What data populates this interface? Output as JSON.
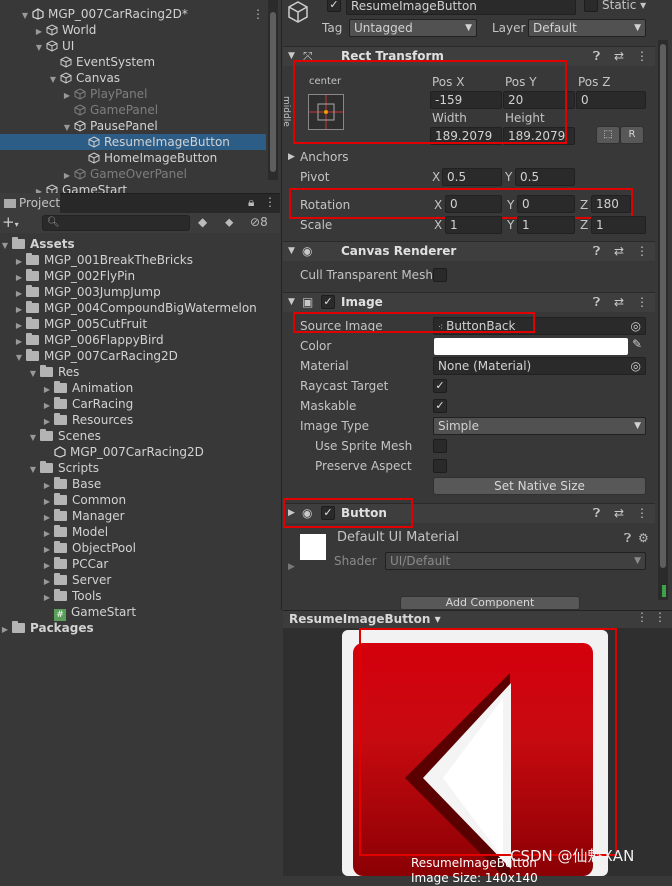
{
  "hierarchy": {
    "rows": [
      {
        "label": "MGP_007CarRacing2D*",
        "indent": 1,
        "arrow": "▼",
        "icon": "unity-scene-icon"
      },
      {
        "label": "World",
        "indent": 2,
        "arrow": "▶",
        "icon": "cube-icon"
      },
      {
        "label": "UI",
        "indent": 2,
        "arrow": "▼",
        "icon": "cube-icon"
      },
      {
        "label": "EventSystem",
        "indent": 3,
        "arrow": "",
        "icon": "cube-icon"
      },
      {
        "label": "Canvas",
        "indent": 3,
        "arrow": "▼",
        "icon": "cube-icon"
      },
      {
        "label": "PlayPanel",
        "indent": 4,
        "arrow": "▶",
        "icon": "cube-icon",
        "dim": true
      },
      {
        "label": "GamePanel",
        "indent": 4,
        "arrow": "",
        "icon": "cube-icon",
        "dim": true
      },
      {
        "label": "PausePanel",
        "indent": 4,
        "arrow": "▼",
        "icon": "cube-icon"
      },
      {
        "label": "ResumeImageButton",
        "indent": 5,
        "arrow": "",
        "icon": "cube-icon",
        "selected": true
      },
      {
        "label": "HomeImageButton",
        "indent": 5,
        "arrow": "",
        "icon": "cube-icon"
      },
      {
        "label": "GameOverPanel",
        "indent": 4,
        "arrow": "▶",
        "icon": "cube-icon",
        "dim": true
      },
      {
        "label": "GameStart",
        "indent": 2,
        "arrow": "▶",
        "icon": "cube-icon"
      }
    ]
  },
  "project": {
    "tab_label": "Project",
    "hidden_count": "8",
    "items": [
      {
        "label": "Assets",
        "indent": 0,
        "arrow": "▼",
        "bold": true,
        "icon": "folder-icon"
      },
      {
        "label": "MGP_001BreakTheBricks",
        "indent": 1,
        "arrow": "▶",
        "icon": "folder-icon"
      },
      {
        "label": "MGP_002FlyPin",
        "indent": 1,
        "arrow": "▶",
        "icon": "folder-icon"
      },
      {
        "label": "MGP_003JumpJump",
        "indent": 1,
        "arrow": "▶",
        "icon": "folder-icon"
      },
      {
        "label": "MGP_004CompoundBigWatermelon",
        "indent": 1,
        "arrow": "▶",
        "icon": "folder-icon"
      },
      {
        "label": "MGP_005CutFruit",
        "indent": 1,
        "arrow": "▶",
        "icon": "folder-icon"
      },
      {
        "label": "MGP_006FlappyBird",
        "indent": 1,
        "arrow": "▶",
        "icon": "folder-icon"
      },
      {
        "label": "MGP_007CarRacing2D",
        "indent": 1,
        "arrow": "▼",
        "icon": "folder-icon"
      },
      {
        "label": "Res",
        "indent": 2,
        "arrow": "▼",
        "icon": "folder-icon"
      },
      {
        "label": "Animation",
        "indent": 3,
        "arrow": "▶",
        "icon": "folder-icon"
      },
      {
        "label": "CarRacing",
        "indent": 3,
        "arrow": "▶",
        "icon": "folder-icon"
      },
      {
        "label": "Resources",
        "indent": 3,
        "arrow": "▶",
        "icon": "folder-icon"
      },
      {
        "label": "Scenes",
        "indent": 2,
        "arrow": "▼",
        "icon": "folder-icon"
      },
      {
        "label": "MGP_007CarRacing2D",
        "indent": 3,
        "arrow": "",
        "icon": "unity-scene-icon"
      },
      {
        "label": "Scripts",
        "indent": 2,
        "arrow": "▼",
        "icon": "folder-icon"
      },
      {
        "label": "Base",
        "indent": 3,
        "arrow": "▶",
        "icon": "folder-icon"
      },
      {
        "label": "Common",
        "indent": 3,
        "arrow": "▶",
        "icon": "folder-icon"
      },
      {
        "label": "Manager",
        "indent": 3,
        "arrow": "▶",
        "icon": "folder-icon"
      },
      {
        "label": "Model",
        "indent": 3,
        "arrow": "▶",
        "icon": "folder-icon"
      },
      {
        "label": "ObjectPool",
        "indent": 3,
        "arrow": "▶",
        "icon": "folder-icon"
      },
      {
        "label": "PCCar",
        "indent": 3,
        "arrow": "▶",
        "icon": "folder-icon"
      },
      {
        "label": "Server",
        "indent": 3,
        "arrow": "▶",
        "icon": "folder-icon"
      },
      {
        "label": "Tools",
        "indent": 3,
        "arrow": "▶",
        "icon": "folder-icon"
      },
      {
        "label": "GameStart",
        "indent": 3,
        "arrow": "",
        "icon": "csharp-script-icon"
      },
      {
        "label": "Packages",
        "indent": 0,
        "arrow": "▶",
        "bold": true,
        "icon": "folder-icon"
      }
    ]
  },
  "inspector": {
    "object_name": "ResumeImageButton",
    "static_label": "Static",
    "tag_label": "Tag",
    "tag_value": "Untagged",
    "layer_label": "Layer",
    "layer_value": "Default",
    "rect_transform": {
      "title": "Rect Transform",
      "anchor_h": "center",
      "anchor_v": "middle",
      "pos_x_label": "Pos X",
      "pos_x": "-159",
      "pos_y_label": "Pos Y",
      "pos_y": "20",
      "pos_z_label": "Pos Z",
      "pos_z": "0",
      "width_label": "Width",
      "width": "189.2079",
      "height_label": "Height",
      "height": "189.2079",
      "r_button": "R",
      "anchors_label": "Anchors",
      "pivot_label": "Pivot",
      "pivot_x": "0.5",
      "pivot_y": "0.5",
      "rotation_label": "Rotation",
      "rot_x": "0",
      "rot_y": "0",
      "rot_z": "180",
      "scale_label": "Scale",
      "scale_x": "1",
      "scale_y": "1",
      "scale_z": "1",
      "x": "X",
      "y": "Y",
      "z": "Z"
    },
    "canvas_renderer": {
      "title": "Canvas Renderer",
      "cull_label": "Cull Transparent Mesh"
    },
    "image": {
      "title": "Image",
      "source_label": "Source Image",
      "source_value": "ButtonBack",
      "color_label": "Color",
      "color_value": "#ffffff",
      "material_label": "Material",
      "material_value": "None (Material)",
      "raycast_label": "Raycast Target",
      "maskable_label": "Maskable",
      "image_type_label": "Image Type",
      "image_type_value": "Simple",
      "use_sprite_mesh_label": "Use Sprite Mesh",
      "preserve_aspect_label": "Preserve Aspect",
      "native_size_button": "Set Native Size"
    },
    "button": {
      "title": "Button"
    },
    "material": {
      "name": "Default UI Material",
      "shader_label": "Shader",
      "shader_value": "UI/Default"
    },
    "add_component": "Add Component"
  },
  "preview": {
    "title": "ResumeImageButton",
    "caption": "ResumeImageButton",
    "size_caption": "Image Size: 140x140"
  },
  "watermark": "CSDN @仙魁XAN",
  "colors": {
    "selection": "#2c5d87",
    "highlight_box": "#e00000",
    "button_red": "#c8000a"
  }
}
